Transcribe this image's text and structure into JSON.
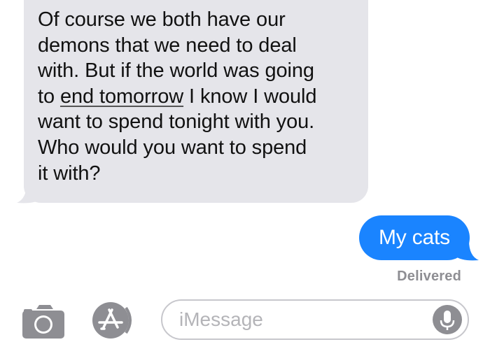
{
  "conversation": {
    "incoming": {
      "lines": [
        "Of course we both have our",
        "demons that we need to deal",
        "with. But if the world was going",
        "to",
        "end tomorrow",
        "I know I would",
        "want to spend tonight with you.",
        "Who would you want to spend",
        "it with?"
      ]
    },
    "outgoing": {
      "text": "My cats",
      "status": "Delivered"
    }
  },
  "input_bar": {
    "camera_icon": "camera-icon",
    "apps_icon": "app-store-icon",
    "placeholder": "iMessage",
    "mic_icon": "microphone-icon"
  },
  "colors": {
    "incoming_bubble": "#e5e5ea",
    "outgoing_bubble": "#1a84ff",
    "icon_gray": "#8e8e93"
  }
}
